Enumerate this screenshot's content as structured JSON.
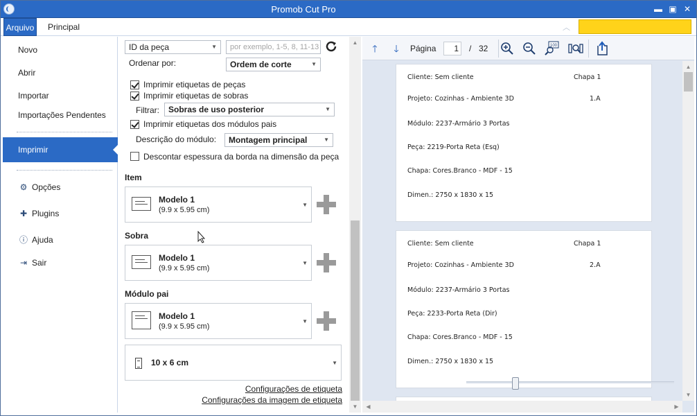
{
  "window": {
    "title": "Promob Cut Pro",
    "controls": [
      "minimize-icon",
      "maximize-icon",
      "close-icon"
    ]
  },
  "ribbon": {
    "tabs": [
      {
        "label": "Arquivo",
        "active": true
      },
      {
        "label": "Principal",
        "active": false
      }
    ],
    "highlight_color": "#ffd31a"
  },
  "sidebar": {
    "items": [
      {
        "label": "Novo"
      },
      {
        "label": "Abrir"
      },
      {
        "label": "Importar"
      },
      {
        "label": "Importações Pendentes"
      },
      {
        "label": "Imprimir",
        "active": true
      },
      {
        "label": "Opções",
        "icon": "gear-icon"
      },
      {
        "label": "Plugins",
        "icon": "puzzle-icon"
      },
      {
        "label": "Ajuda",
        "icon": "help-icon"
      },
      {
        "label": "Sair",
        "icon": "exit-icon"
      }
    ]
  },
  "print": {
    "piece_selector": {
      "value": "ID da peça"
    },
    "range_input": {
      "placeholder": "por exemplo, 1-5, 8, 11-13"
    },
    "order_by": {
      "label": "Ordenar por:",
      "value": "Ordem de corte"
    },
    "print_piece_labels": {
      "label": "Imprimir etiquetas de peças",
      "checked": true
    },
    "print_leftover_labels": {
      "label": "Imprimir etiquetas de sobras",
      "checked": true
    },
    "filter": {
      "label": "Filtrar:",
      "value": "Sobras de uso posterior"
    },
    "print_parent_module_labels": {
      "label": "Imprimir etiquetas dos módulos pais",
      "checked": true
    },
    "module_description": {
      "label": "Descrição do módulo:",
      "value": "Montagem principal"
    },
    "discount_edge": {
      "label": "Descontar espessura da borda na dimensão da peça",
      "checked": false
    },
    "sections": [
      {
        "title": "Item",
        "model": "Modelo 1",
        "size": "(9.9 x 5.95 cm)"
      },
      {
        "title": "Sobra",
        "model": "Modelo 1",
        "size": "(9.9 x 5.95 cm)"
      },
      {
        "title": "Módulo pai",
        "model": "Modelo 1",
        "size": "(9.9 x 5.95 cm)"
      }
    ],
    "paper_size": "10 x 6 cm",
    "links": {
      "label_settings": "Configurações de etiqueta",
      "label_image_settings": "Configurações da imagem de etiqueta"
    }
  },
  "preview": {
    "toolbar": {
      "page_label": "Página",
      "page_current": "1",
      "page_separator": "/",
      "page_total": "32",
      "icons": [
        "arrow-up-icon",
        "arrow-down-icon",
        "zoom-in-icon",
        "zoom-out-icon",
        "zoom-100-icon",
        "fit-page-icon",
        "export-icon"
      ]
    },
    "labels": [
      {
        "cliente": "Cliente: Sem cliente",
        "chapa_num": "Chapa 1",
        "projeto": "Projeto: Cozinhas - Ambiente 3D",
        "code": "1.A",
        "modulo": "Módulo: 2237-Armário 3 Portas",
        "peca": "Peça: 2219-Porta Reta (Esq)",
        "chapa": "Chapa: Cores.Branco - MDF - 15",
        "dimen": "Dimen.: 2750 x 1830 x 15"
      },
      {
        "cliente": "Cliente: Sem cliente",
        "chapa_num": "Chapa 1",
        "projeto": "Projeto: Cozinhas - Ambiente 3D",
        "code": "2.A",
        "modulo": "Módulo: 2237-Armário 3 Portas",
        "peca": "Peça: 2233-Porta Reta (Dir)",
        "chapa": "Chapa: Cores.Branco - MDF - 15",
        "dimen": "Dimen.: 2750 x 1830 x 15"
      }
    ]
  }
}
